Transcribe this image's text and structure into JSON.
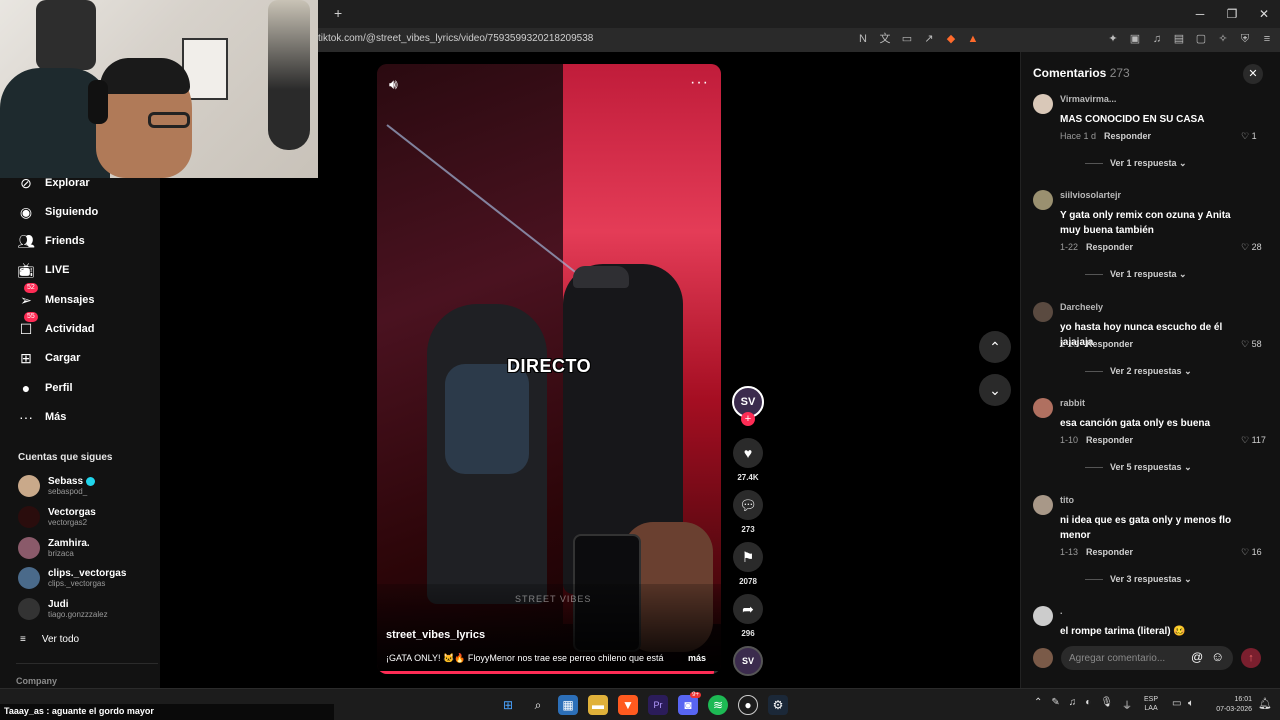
{
  "browser": {
    "url": "tiktok.com/@street_vibes_lyrics/video/7593599320218209538",
    "new_tab": "+",
    "controls": [
      "─",
      "❐",
      "✕"
    ]
  },
  "sidebar": {
    "items": [
      {
        "label": "Explorar",
        "icon": "compass-icon"
      },
      {
        "label": "Siguiendo",
        "icon": "following-icon"
      },
      {
        "label": "Friends",
        "icon": "friends-icon"
      },
      {
        "label": "LIVE",
        "icon": "live-icon"
      },
      {
        "label": "Mensajes",
        "icon": "messages-icon",
        "badge": "52"
      },
      {
        "label": "Actividad",
        "icon": "activity-icon",
        "badge": "55"
      },
      {
        "label": "Cargar",
        "icon": "upload-icon"
      },
      {
        "label": "Perfil",
        "icon": "profile-icon"
      },
      {
        "label": "Más",
        "icon": "more-icon"
      }
    ],
    "following_title": "Cuentas que sigues",
    "accounts": [
      {
        "name": "Sebass",
        "handle": "sebaspod_",
        "verified": true
      },
      {
        "name": "Vectorgas",
        "handle": "vectorgas2"
      },
      {
        "name": "Zamhira.",
        "handle": "brizaca"
      },
      {
        "name": "clips._vectorgas",
        "handle": "clips._vectorgas"
      },
      {
        "name": "Judi",
        "handle": "tiago.gonzzzalez"
      }
    ],
    "see_all": "Ver todo",
    "company": "Company"
  },
  "video": {
    "overlay_text": "DIRECTO",
    "watermark": "STREET VIBES",
    "author": "street_vibes_lyrics",
    "caption": "¡GATA ONLY! 🐱🔥 FloyyMenor nos trae ese perreo chileno que está",
    "more": "más",
    "progress": 0.98,
    "creator_initials": "SV"
  },
  "actions": [
    {
      "name": "like",
      "icon": "heart-icon",
      "count": "27.4K"
    },
    {
      "name": "comment",
      "icon": "comment-icon",
      "count": "273"
    },
    {
      "name": "save",
      "icon": "bookmark-icon",
      "count": "2078"
    },
    {
      "name": "share",
      "icon": "share-icon",
      "count": "296"
    }
  ],
  "comments_panel": {
    "title": "Comentarios",
    "count": "273",
    "items": [
      {
        "user": "Virmavirma...",
        "text": "MAS CONOCIDO EN SU CASA",
        "time": "Hace 1 d",
        "reply": "Responder",
        "likes": "1",
        "replies": "Ver 1 respuesta"
      },
      {
        "user": "siilviosolartejr",
        "text": "Y gata only remix con ozuna y Anita muy buena también",
        "time": "1-22",
        "reply": "Responder",
        "likes": "28",
        "replies": "Ver 1 respuesta"
      },
      {
        "user": "Darcheely",
        "text": "yo hasta hoy nunca escucho de él jajajaja",
        "time": "1-10",
        "reply": "Responder",
        "likes": "58",
        "replies": "Ver 2 respuestas"
      },
      {
        "user": "rabbit",
        "text": "esa canción gata only es buena",
        "time": "1-10",
        "reply": "Responder",
        "likes": "117",
        "replies": "Ver 5 respuestas"
      },
      {
        "user": "tito",
        "text": "ni idea que es gata only y menos flo menor",
        "time": "1-13",
        "reply": "Responder",
        "likes": "16",
        "replies": "Ver 3 respuestas"
      },
      {
        "user": ".",
        "text": "el rompe tarima (literal) 🥴"
      }
    ],
    "input_placeholder": "Agregar comentario..."
  },
  "chat": {
    "message": "Taaay_as : aguante el gordo mayor"
  },
  "taskbar": {
    "lang_top": "ESP",
    "lang_bottom": "LAA",
    "time": "16:01",
    "date": "07-03-2026",
    "discord_badge": "9+"
  }
}
